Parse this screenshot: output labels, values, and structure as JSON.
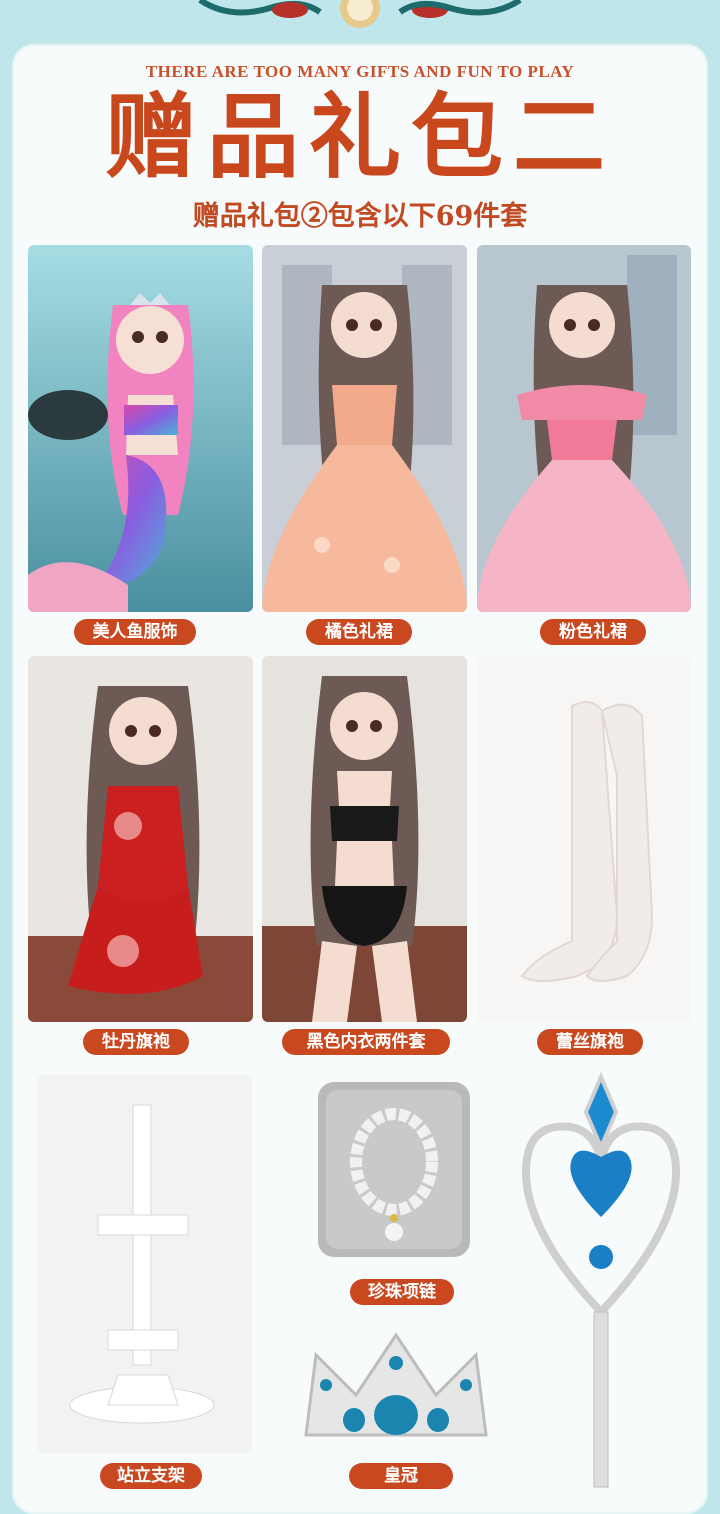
{
  "header": {
    "subtitle_en": "THERE ARE TOO MANY GIFTS AND FUN TO PLAY",
    "title_cn": "赠品礼包二",
    "desc_cn": "赠品礼包②包含以下69件套"
  },
  "items": [
    {
      "label": "美人鱼服饰",
      "icon": "mermaid-doll-photo"
    },
    {
      "label": "橘色礼裙",
      "icon": "orange-gown-doll-photo"
    },
    {
      "label": "粉色礼裙",
      "icon": "pink-gown-doll-photo"
    },
    {
      "label": "牡丹旗袍",
      "icon": "peony-qipao-doll-photo"
    },
    {
      "label": "黑色内衣两件套",
      "icon": "black-underwear-doll-photo"
    },
    {
      "label": "蕾丝旗袍",
      "icon": "lace-stockings-photo"
    },
    {
      "label": "站立支架",
      "icon": "doll-stand-photo"
    },
    {
      "label": "珍珠项链",
      "icon": "pearl-necklace-photo"
    },
    {
      "label": "皇冠",
      "icon": "crown-photo"
    }
  ],
  "colors": {
    "accent": "#c9481f",
    "background": "#bfe6ea",
    "card": "#f8fbfc"
  }
}
